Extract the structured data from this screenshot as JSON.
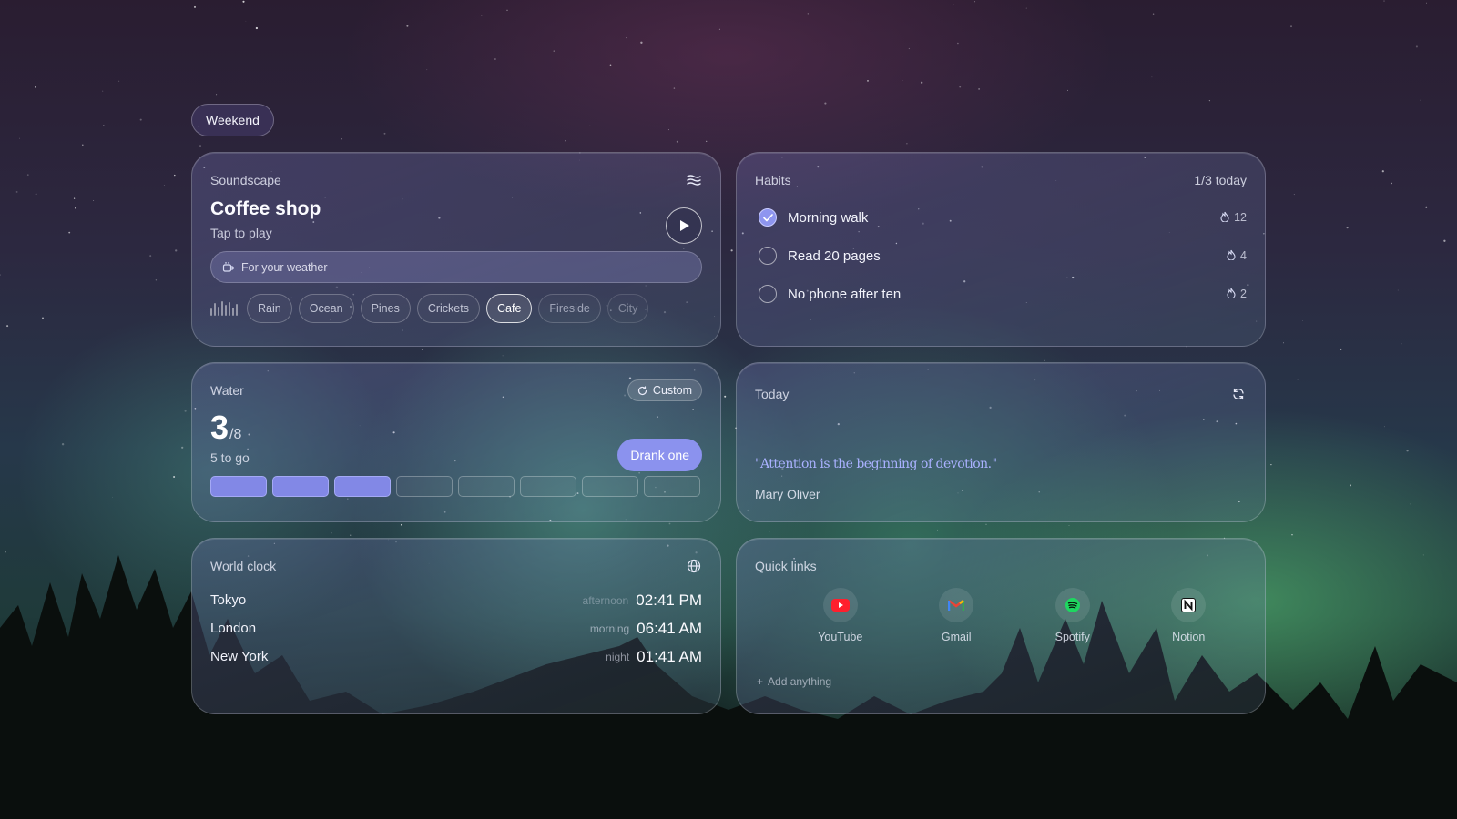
{
  "tag": "Weekend",
  "soundscape": {
    "title": "Soundscape",
    "name": "Coffee shop",
    "subtitle": "Tap to play",
    "weather_label": "For your weather",
    "chips": [
      "Rain",
      "Ocean",
      "Pines",
      "Crickets",
      "Cafe",
      "Fireside",
      "City"
    ],
    "active_chip": "Cafe"
  },
  "habits": {
    "title": "Habits",
    "progress": "1/3 today",
    "items": [
      {
        "label": "Morning walk",
        "streak": "12",
        "done": true
      },
      {
        "label": "Read 20 pages",
        "streak": "4",
        "done": false
      },
      {
        "label": "No phone after ten",
        "streak": "2",
        "done": false
      }
    ]
  },
  "water": {
    "title": "Water",
    "custom_label": "Custom",
    "count": "3",
    "goal": "/8",
    "remaining": "5 to go",
    "button": "Drank one",
    "filled": 3,
    "total": 8,
    "accent": "#8288e6"
  },
  "today": {
    "title": "Today",
    "quote": "\"Attention is the beginning of devotion.\"",
    "author": "Mary Oliver"
  },
  "world_clock": {
    "title": "World clock",
    "cities": [
      {
        "city": "Tokyo",
        "period": "afternoon",
        "time": "02:41 PM"
      },
      {
        "city": "London",
        "period": "morning",
        "time": "06:41 AM"
      },
      {
        "city": "New York",
        "period": "night",
        "time": "01:41 AM"
      }
    ]
  },
  "quick_links": {
    "title": "Quick links",
    "links": [
      {
        "label": "YouTube",
        "icon": "youtube-icon"
      },
      {
        "label": "Gmail",
        "icon": "gmail-icon"
      },
      {
        "label": "Spotify",
        "icon": "spotify-icon"
      },
      {
        "label": "Notion",
        "icon": "notion-icon"
      }
    ],
    "add_label": "Add anything"
  }
}
